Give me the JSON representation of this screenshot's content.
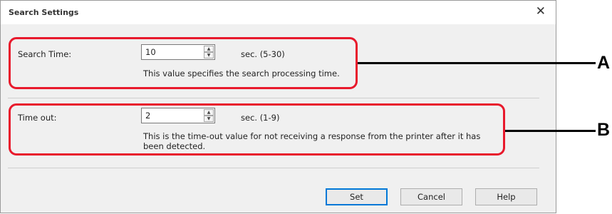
{
  "dialog": {
    "title": "Search Settings",
    "close_glyph": "✕"
  },
  "search_time": {
    "label": "Search Time:",
    "value": "10",
    "unit": "sec. (5-30)",
    "description": "This value specifies the search processing time."
  },
  "time_out": {
    "label": "Time out:",
    "value": "2",
    "unit": "sec. (1-9)",
    "description_line1": "This is the time-out value for not receiving a response from the printer after it has",
    "description_line2": "been detected."
  },
  "spinner": {
    "up_glyph": "▲",
    "down_glyph": "▼"
  },
  "buttons": {
    "set": "Set",
    "cancel": "Cancel",
    "help": "Help"
  },
  "callouts": {
    "a": "A",
    "b": "B"
  },
  "colors": {
    "highlight": "#e8192c",
    "default_button_border": "#0078d7",
    "dialog_bg": "#f0f0f0"
  }
}
